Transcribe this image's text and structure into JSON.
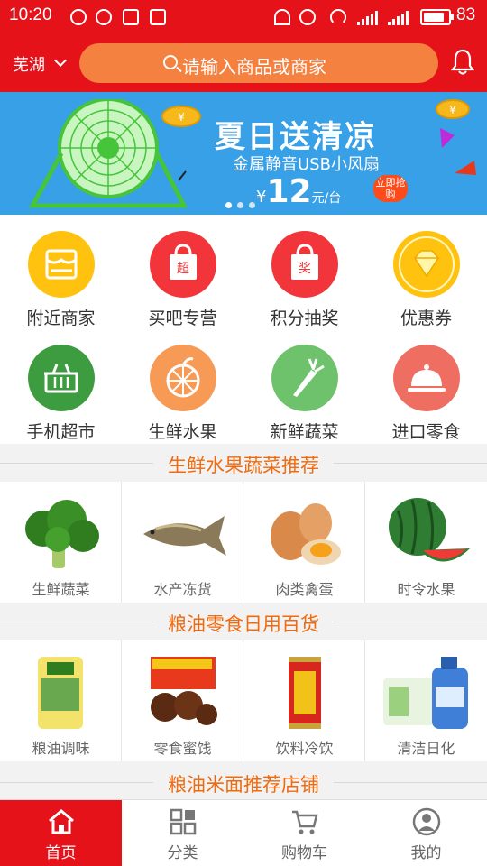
{
  "status_bar": {
    "time": "10:20",
    "battery": "83",
    "battery_level": 0.83
  },
  "header": {
    "city": "芜湖",
    "search_placeholder": "请输入商品或商家"
  },
  "banner": {
    "title": "夏日送清凉",
    "subtitle": "金属静音USB小风扇",
    "price_symbol": "¥",
    "price": "12",
    "price_unit": "元/台",
    "buy_badge": "立即抢购",
    "slide_count": 3,
    "active_slide": 0
  },
  "categories": [
    {
      "label": "附近商家",
      "icon": "storefront-icon",
      "color": "#ffc20e"
    },
    {
      "label": "买吧专营",
      "icon": "chao-bag-icon",
      "color": "#f2353a"
    },
    {
      "label": "积分抽奖",
      "icon": "jiang-bag-icon",
      "color": "#f2353a"
    },
    {
      "label": "优惠券",
      "icon": "diamond-icon",
      "color": "#ffc20e"
    },
    {
      "label": "手机超市",
      "icon": "basket-icon",
      "color": "#3d9c3f"
    },
    {
      "label": "生鲜水果",
      "icon": "orange-slice-icon",
      "color": "#f79a56"
    },
    {
      "label": "新鲜蔬菜",
      "icon": "carrot-icon",
      "color": "#6ec26b"
    },
    {
      "label": "进口零食",
      "icon": "cloche-icon",
      "color": "#ef6e62"
    }
  ],
  "sections": [
    {
      "title": "生鲜水果蔬菜推荐",
      "items": [
        {
          "label": "生鲜蔬菜",
          "icon": "broccoli-icon"
        },
        {
          "label": "水产冻货",
          "icon": "fish-icon"
        },
        {
          "label": "肉类禽蛋",
          "icon": "eggs-icon"
        },
        {
          "label": "时令水果",
          "icon": "watermelon-icon"
        }
      ]
    },
    {
      "title": "粮油零食日用百货",
      "items": [
        {
          "label": "粮油调味",
          "icon": "rice-bag-icon"
        },
        {
          "label": "零食蜜饯",
          "icon": "snack-box-icon"
        },
        {
          "label": "饮料冷饮",
          "icon": "drink-can-icon"
        },
        {
          "label": "清洁日化",
          "icon": "detergent-icon"
        }
      ]
    },
    {
      "title": "粮油米面推荐店铺"
    }
  ],
  "nav": {
    "tabs": [
      {
        "label": "首页",
        "icon": "home-icon",
        "active": true
      },
      {
        "label": "分类",
        "icon": "grid-icon",
        "active": false
      },
      {
        "label": "购物车",
        "icon": "cart-icon",
        "active": false
      },
      {
        "label": "我的",
        "icon": "user-icon",
        "active": false
      }
    ]
  },
  "colors": {
    "brand": "#e5121a",
    "accent": "#f06a0f",
    "search_bg": "#f4813f",
    "banner_bg": "#37a0e7"
  }
}
